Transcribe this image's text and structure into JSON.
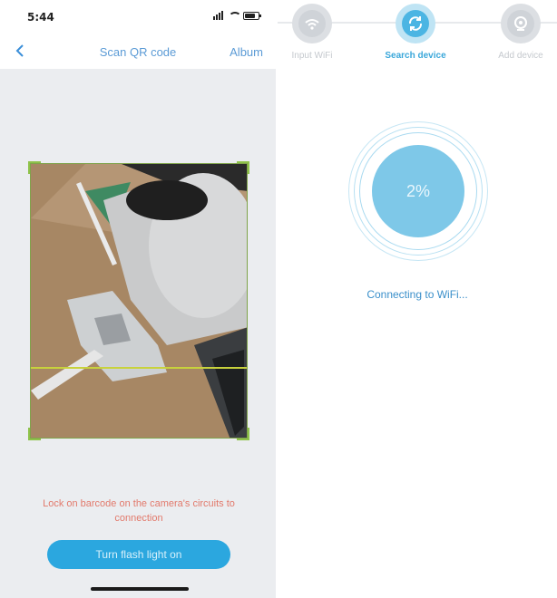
{
  "left_screen": {
    "status_bar": {
      "time": "5:44"
    },
    "nav": {
      "back_icon": "chevron-left-icon",
      "title": "Scan QR code",
      "album": "Album"
    },
    "hint": "Lock on barcode on the camera's circuits to connection",
    "flash_button": "Turn flash light on"
  },
  "right_screen": {
    "steps": [
      {
        "label": "Input WiFi",
        "icon": "wifi-icon",
        "active": false
      },
      {
        "label": "Search device",
        "icon": "refresh-icon",
        "active": true
      },
      {
        "label": "Add device",
        "icon": "camera-icon",
        "active": false
      }
    ],
    "progress": {
      "percent_text": "2%",
      "value": 0.02
    },
    "status": "Connecting to WiFi..."
  },
  "colors": {
    "accent": "#2ba7df",
    "step_active": "#4bb5e3",
    "progress_disc": "#7ec8e8",
    "hint_text": "#e27a6c",
    "scan_frame": "#8ec24a"
  }
}
